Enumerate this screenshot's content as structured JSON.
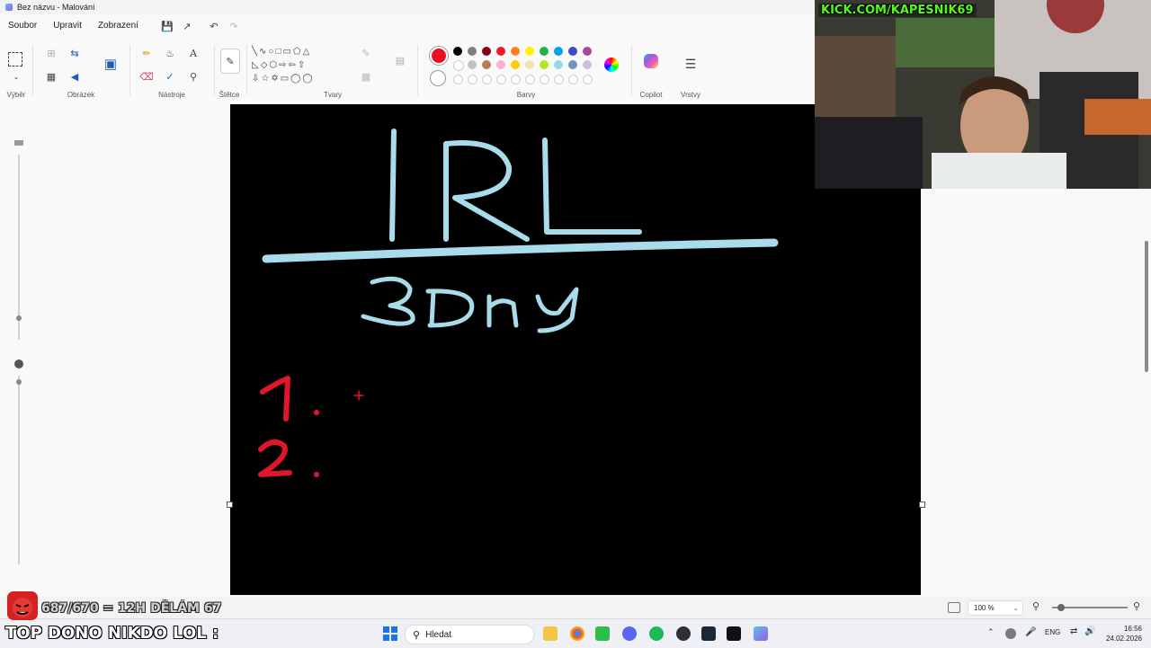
{
  "window": {
    "title": "Bez názvu - Malování"
  },
  "menu": {
    "file": "Soubor",
    "edit": "Upravit",
    "view": "Zobrazení"
  },
  "ribbon": {
    "groups": {
      "selection": "Výběr",
      "image": "Obrázek",
      "tools": "Nástroje",
      "brushes": "Štětce",
      "shapes": "Tvary",
      "colors": "Barvy",
      "copilot": "Copilot",
      "layers": "Vrstvy"
    },
    "active_color": "#e81123",
    "palette_row1": [
      "#000000",
      "#7f7f7f",
      "#880015",
      "#ed1c24",
      "#ff7f27",
      "#fff200",
      "#22b14c",
      "#00a2e8",
      "#3f48cc",
      "#a349a4"
    ],
    "palette_row2": [
      "#ffffff",
      "#c3c3c3",
      "#b97a57",
      "#ffaec9",
      "#ffc90e",
      "#efe4b0",
      "#b5e61d",
      "#99d9ea",
      "#7092be",
      "#c8bfe7"
    ]
  },
  "canvas": {
    "background": "#000000",
    "ink_blue": "#a8dcea",
    "ink_red": "#e0162b",
    "text_irl": "IRL",
    "text_days": "3Dny",
    "list_1": "1.",
    "list_2": "2."
  },
  "overlay": {
    "stream_url": "KICK.COM/KAPESNIK69",
    "goal_text": "687/670 = 12H DĚLÁM 67",
    "top_dono": "TOP DONO NIKDO LOL :"
  },
  "statusbar": {
    "zoom": "100 %"
  },
  "taskbar": {
    "search_placeholder": "Hledat",
    "language": "ENG",
    "time": "16:56",
    "date": "24.02.2026"
  }
}
